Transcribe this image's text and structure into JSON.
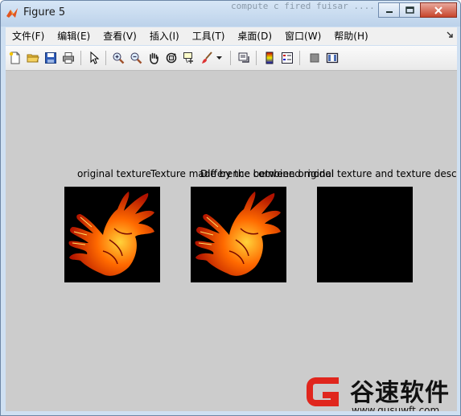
{
  "window": {
    "title": "Figure 5",
    "background_text": "compute  c  fired  fuisar  ...."
  },
  "menubar": {
    "items": [
      "文件(F)",
      "编辑(E)",
      "查看(V)",
      "插入(I)",
      "工具(T)",
      "桌面(D)",
      "窗口(W)",
      "帮助(H)"
    ]
  },
  "toolbar": {
    "buttons": [
      "new-figure",
      "open-file",
      "save",
      "print",
      "edit-plot",
      "zoom-in",
      "zoom-out",
      "pan",
      "rotate-3d",
      "data-cursor",
      "brush",
      "link-plot",
      "colorbar",
      "legend",
      "hide-plot-tools",
      "show-plot-tools"
    ]
  },
  "figure": {
    "axes_titles": {
      "a1": "original texture",
      "a2": "Texture made by the combined model",
      "a3_overlap": "Difference between original texture and texture described"
    }
  },
  "watermark": {
    "brand": "谷速软件",
    "url": "www.gusuwft.com"
  },
  "colors": {
    "figure_bg": "#cccccc",
    "title_bar": "#c8dbf0",
    "close_button": "#c7442b",
    "watermark_red": "#e0261d"
  }
}
